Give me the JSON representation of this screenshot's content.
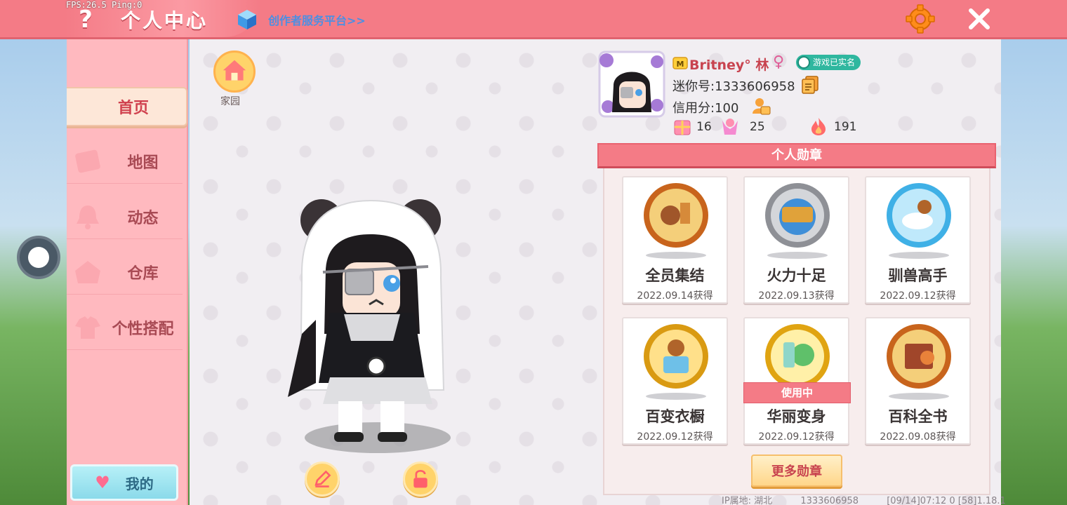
{
  "debug": {
    "fps_text": "FPS:26.5  Ping:0"
  },
  "header": {
    "help_icon": "?",
    "title": "个人中心",
    "creator_link": "创作者服务平台>>",
    "icons": {
      "help": "help-icon",
      "cube": "cube-icon",
      "settings": "gear-icon",
      "close": "close-icon"
    }
  },
  "sidebar": {
    "items": [
      {
        "label": "首页",
        "active": true
      },
      {
        "label": "地图",
        "active": false
      },
      {
        "label": "动态",
        "active": false
      },
      {
        "label": "仓库",
        "active": false
      },
      {
        "label": "个性搭配",
        "active": false
      }
    ],
    "my_button": "我的"
  },
  "home": {
    "label": "家园"
  },
  "profile": {
    "nickname": "Britney°  林",
    "gender_icon": "♀",
    "realname_badge": "游戏已实名",
    "mini_id": "迷你号:1333606958",
    "credit": "信用分:100",
    "stats": [
      {
        "icon": "gift-box-icon",
        "value": "16"
      },
      {
        "icon": "praise-icon",
        "value": "25"
      },
      {
        "icon": "fire-icon",
        "value": "191"
      }
    ]
  },
  "medals": {
    "header": "个人勋章",
    "items": [
      {
        "name": "全员集结",
        "date": "2022.09.14获得",
        "color": "#e8823a",
        "in_use": false
      },
      {
        "name": "火力十足",
        "date": "2022.09.13获得",
        "color": "#b9bcc2",
        "in_use": false
      },
      {
        "name": "驯兽高手",
        "date": "2022.09.12获得",
        "color": "#5cc8f0",
        "in_use": false
      },
      {
        "name": "百变衣橱",
        "date": "2022.09.12获得",
        "color": "#f2b41c",
        "in_use": false
      },
      {
        "name": "华丽变身",
        "date": "2022.09.12获得",
        "color": "#f2c21c",
        "in_use": true
      },
      {
        "name": "百科全书",
        "date": "2022.09.08获得",
        "color": "#e8823a",
        "in_use": false
      }
    ],
    "in_use_label": "使用中",
    "more_button": "更多勋章"
  },
  "footer": {
    "ip_location": "IP属地: 湖北",
    "id": "1333606958",
    "version": "[09/14]07:12 0  [58]1.18.1"
  },
  "colors": {
    "accent": "#f47b86",
    "title_text": "#c8434f",
    "sidebar": "#ffb9bf",
    "link": "#4c8fe3"
  }
}
